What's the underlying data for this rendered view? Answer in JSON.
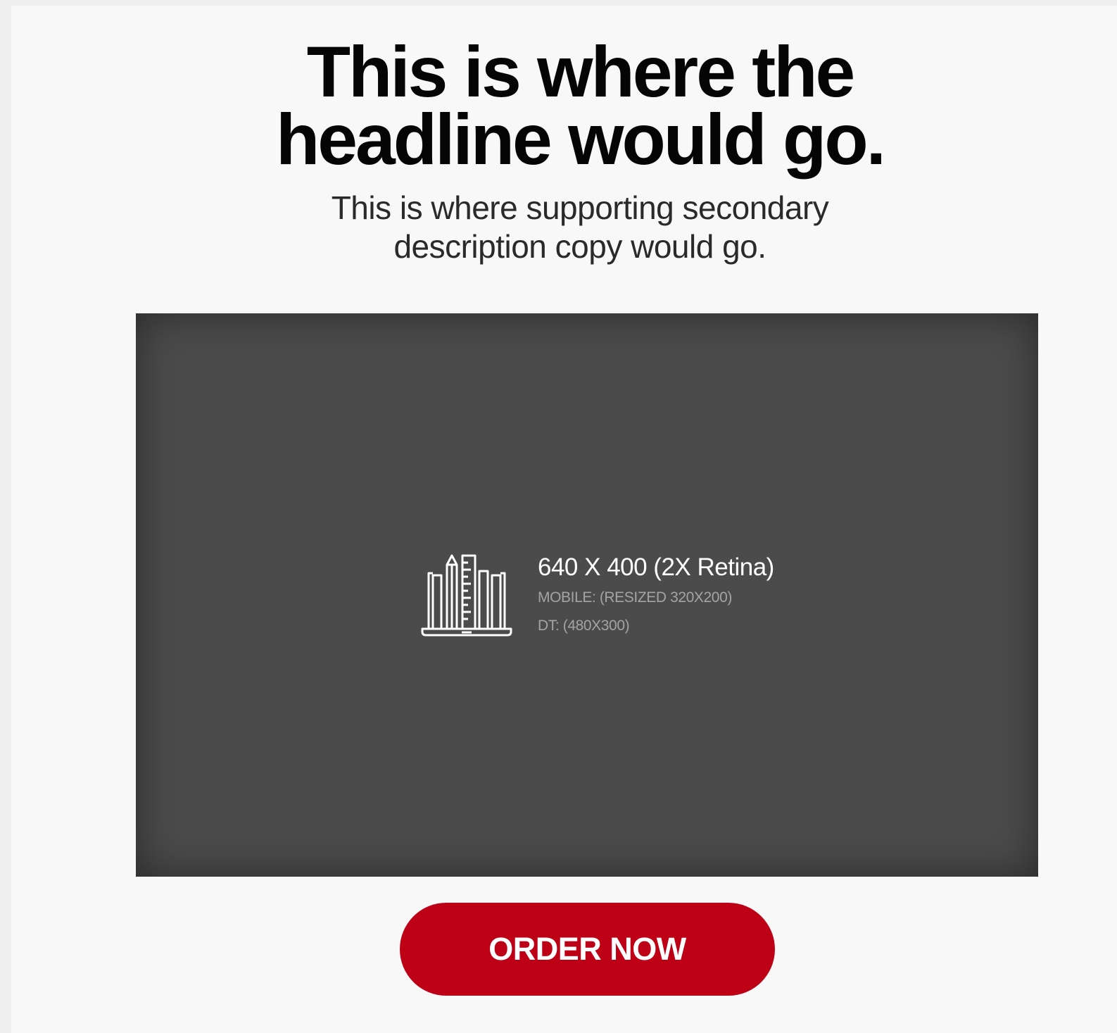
{
  "hero": {
    "headline_line1": "This is where the",
    "headline_line2": "headline would go.",
    "subcopy_line1": "This is where supporting secondary",
    "subcopy_line2": "description copy would go."
  },
  "image_placeholder": {
    "icon": "laptop-with-pencil-ruler-icon",
    "dimensions": "640 X 400 (2X Retina)",
    "mobile_note": "MOBILE: (RESIZED 320X200)",
    "desktop_note": "DT: (480X300)"
  },
  "cta": {
    "label": "ORDER NOW"
  },
  "colors": {
    "background": "#efefef",
    "card": "#f8f8f8",
    "headline": "#050505",
    "placeholder": "#4b4b4b",
    "cta": "#bd0016",
    "cta_text": "#ffffff"
  }
}
